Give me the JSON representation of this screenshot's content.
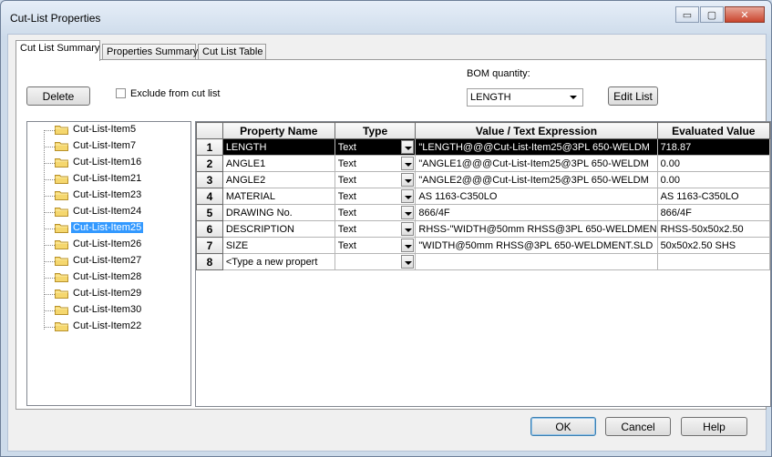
{
  "window": {
    "title": "Cut-List Properties",
    "controls": {
      "minimize": "▭",
      "maximize": "▢",
      "close": "✕"
    }
  },
  "tabs": [
    {
      "label": "Cut List Summary",
      "active": true
    },
    {
      "label": "Properties Summary",
      "active": false
    },
    {
      "label": "Cut List Table",
      "active": false
    }
  ],
  "toolbar": {
    "delete_label": "Delete",
    "exclude_label": "Exclude from cut list",
    "bom_label": "BOM quantity:",
    "bom_value": "LENGTH",
    "edit_list_label": "Edit List"
  },
  "tree": {
    "items": [
      "Cut-List-Item5",
      "Cut-List-Item7",
      "Cut-List-Item16",
      "Cut-List-Item21",
      "Cut-List-Item23",
      "Cut-List-Item24",
      "Cut-List-Item25",
      "Cut-List-Item26",
      "Cut-List-Item27",
      "Cut-List-Item28",
      "Cut-List-Item29",
      "Cut-List-Item30",
      "Cut-List-Item22"
    ],
    "selected": "Cut-List-Item25"
  },
  "grid": {
    "headers": [
      "Property Name",
      "Type",
      "Value / Text Expression",
      "Evaluated Value"
    ],
    "rows": [
      {
        "num": "1",
        "name": "LENGTH",
        "type": "Text",
        "value": "\"LENGTH@@@Cut-List-Item25@3PL 650-WELDM",
        "evaluated": "718.87"
      },
      {
        "num": "2",
        "name": "ANGLE1",
        "type": "Text",
        "value": "\"ANGLE1@@@Cut-List-Item25@3PL 650-WELDM",
        "evaluated": "0.00"
      },
      {
        "num": "3",
        "name": "ANGLE2",
        "type": "Text",
        "value": "\"ANGLE2@@@Cut-List-Item25@3PL 650-WELDM",
        "evaluated": "0.00"
      },
      {
        "num": "4",
        "name": "MATERIAL",
        "type": "Text",
        "value": "AS 1163-C350LO",
        "evaluated": "AS 1163-C350LO"
      },
      {
        "num": "5",
        "name": "DRAWING No.",
        "type": "Text",
        "value": "866/4F",
        "evaluated": "866/4F"
      },
      {
        "num": "6",
        "name": "DESCRIPTION",
        "type": "Text",
        "value": "RHSS-\"WIDTH@50mm RHSS@3PL 650-WELDMEN",
        "evaluated": "RHSS-50x50x2.50"
      },
      {
        "num": "7",
        "name": "SIZE",
        "type": "Text",
        "value": "\"WIDTH@50mm RHSS@3PL 650-WELDMENT.SLD",
        "evaluated": "50x50x2.50 SHS"
      },
      {
        "num": "8",
        "name": "<Type a new propert",
        "type": "",
        "value": "",
        "evaluated": ""
      }
    ]
  },
  "footer": {
    "ok_label": "OK",
    "cancel_label": "Cancel",
    "help_label": "Help"
  }
}
